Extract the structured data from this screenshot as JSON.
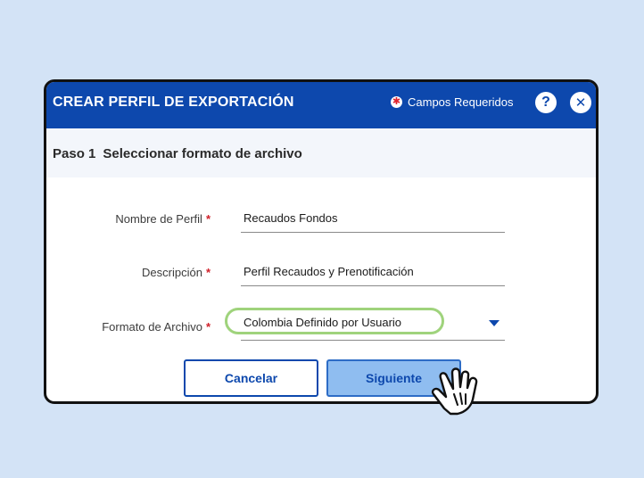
{
  "dialog": {
    "title": "CREAR PERFIL DE EXPORTACIÓN",
    "required_label": "Campos Requeridos",
    "required_icon": "asterisk-icon",
    "help_icon": "help-icon",
    "help_glyph": "?",
    "close_icon": "close-icon",
    "close_glyph": "✕"
  },
  "step": {
    "number": "Paso 1",
    "title": "Seleccionar formato de archivo"
  },
  "form": {
    "profile_name": {
      "label": "Nombre de Perfil",
      "required": "*",
      "value": "Recaudos Fondos"
    },
    "description": {
      "label": "Descripción",
      "required": "*",
      "value": "Perfil Recaudos y Prenotificación"
    },
    "file_format": {
      "label": "Formato de Archivo",
      "required": "*",
      "value": "Colombia Definido por Usuario"
    }
  },
  "actions": {
    "cancel_label": "Cancelar",
    "next_label": "Siguiente"
  },
  "colors": {
    "background": "#d3e3f6",
    "header": "#0d48ad",
    "highlight": "#9fd37c",
    "next_button": "#8fbdf0",
    "required_star": "#d0202a"
  }
}
